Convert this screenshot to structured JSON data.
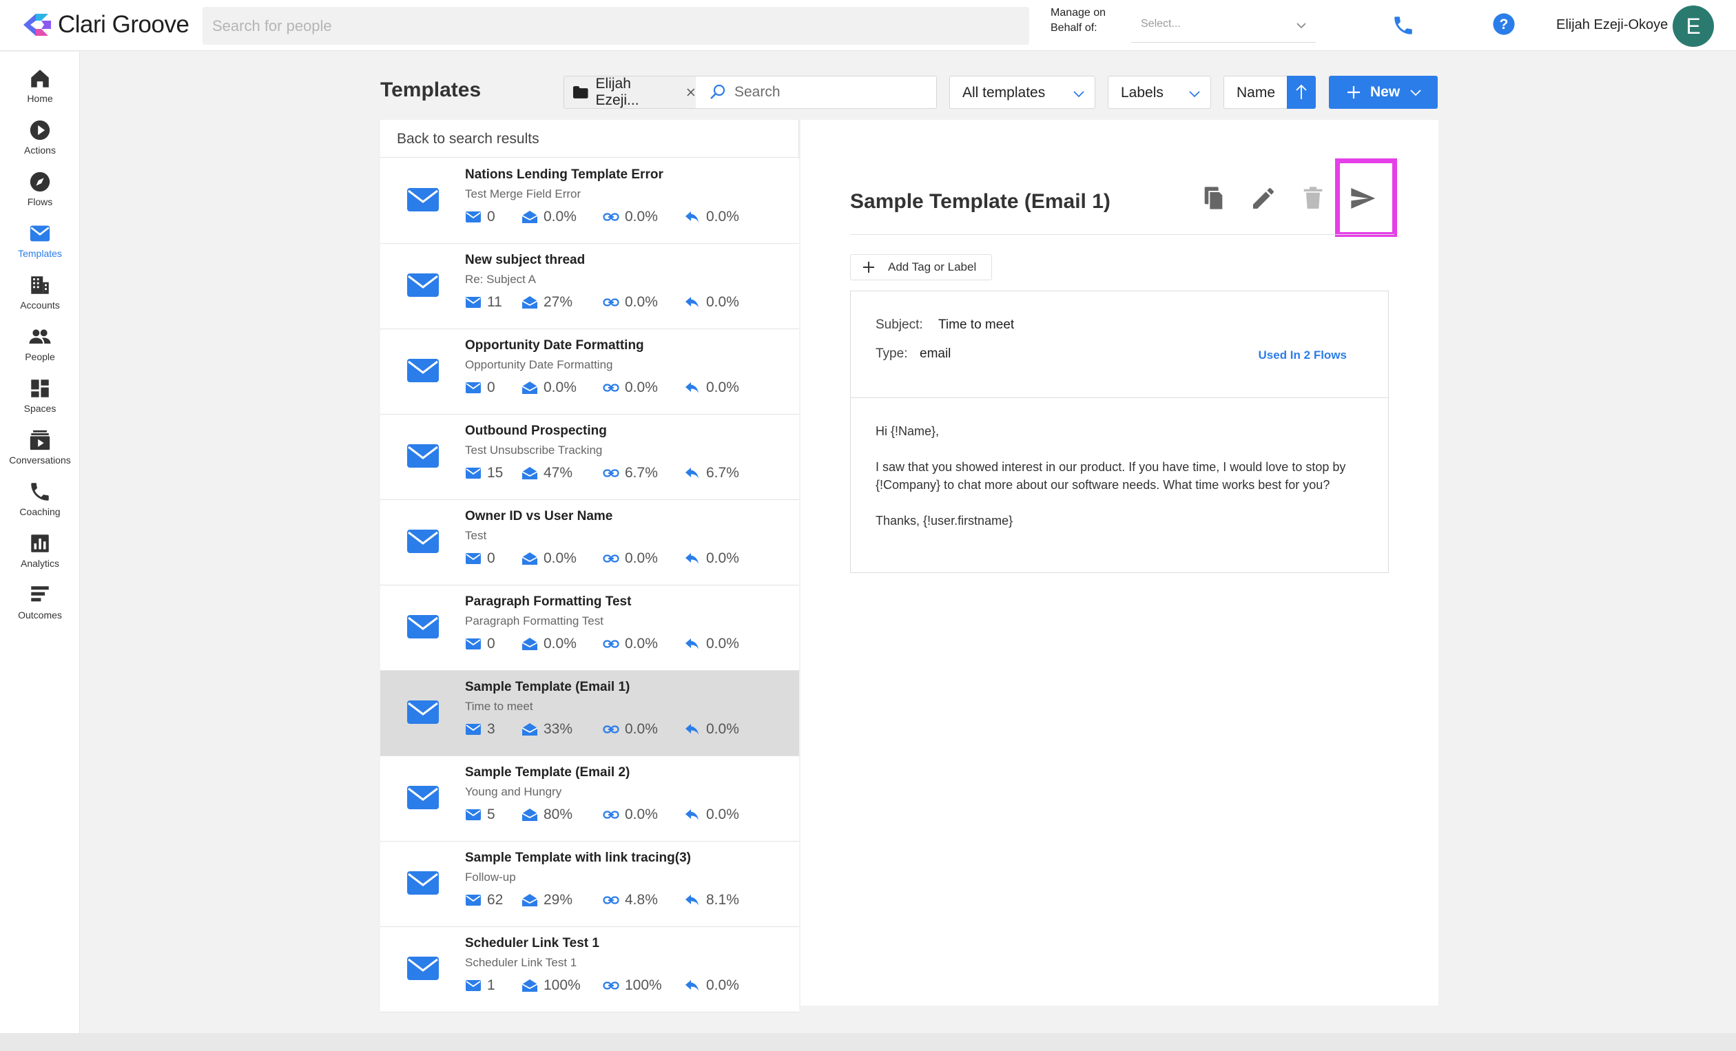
{
  "app": {
    "brand": "Clari Groove"
  },
  "header": {
    "people_search_placeholder": "Search for people",
    "manage_label": "Manage on Behalf of:",
    "behalf_placeholder": "Select...",
    "user_name": "Elijah Ezeji-Okoye",
    "avatar_initial": "E"
  },
  "sidebar": {
    "items": [
      {
        "label": "Home",
        "icon": "home-icon"
      },
      {
        "label": "Actions",
        "icon": "play-circle-icon"
      },
      {
        "label": "Flows",
        "icon": "compass-icon"
      },
      {
        "label": "Templates",
        "icon": "envelope-icon",
        "active": true
      },
      {
        "label": "Accounts",
        "icon": "building-icon"
      },
      {
        "label": "People",
        "icon": "people-icon"
      },
      {
        "label": "Spaces",
        "icon": "dashboard-icon"
      },
      {
        "label": "Conversations",
        "icon": "conversations-icon"
      },
      {
        "label": "Coaching",
        "icon": "phone-icon"
      },
      {
        "label": "Analytics",
        "icon": "bar-chart-icon"
      },
      {
        "label": "Outcomes",
        "icon": "list-icon"
      }
    ]
  },
  "toolbar": {
    "title": "Templates",
    "folder_filter": "Elijah Ezeji...",
    "search_placeholder": "Search",
    "all_templates": "All templates",
    "labels": "Labels",
    "sort": "Name",
    "new_label": "New"
  },
  "list": {
    "back_label": "Back to search results",
    "rows": [
      {
        "title": "Nations Lending Template Error",
        "subject": "Test Merge Field Error",
        "sent": "0",
        "opened": "0.0%",
        "clicked": "0.0%",
        "replied": "0.0%"
      },
      {
        "title": "New subject thread",
        "subject": "Re: Subject A",
        "sent": "11",
        "opened": "27%",
        "clicked": "0.0%",
        "replied": "0.0%"
      },
      {
        "title": "Opportunity Date Formatting",
        "subject": "Opportunity Date Formatting",
        "sent": "0",
        "opened": "0.0%",
        "clicked": "0.0%",
        "replied": "0.0%"
      },
      {
        "title": "Outbound Prospecting",
        "subject": "Test Unsubscribe Tracking",
        "sent": "15",
        "opened": "47%",
        "clicked": "6.7%",
        "replied": "6.7%"
      },
      {
        "title": "Owner ID vs User Name",
        "subject": "Test",
        "sent": "0",
        "opened": "0.0%",
        "clicked": "0.0%",
        "replied": "0.0%"
      },
      {
        "title": "Paragraph Formatting Test",
        "subject": "Paragraph Formatting Test",
        "sent": "0",
        "opened": "0.0%",
        "clicked": "0.0%",
        "replied": "0.0%"
      },
      {
        "title": "Sample Template (Email 1)",
        "subject": "Time to meet",
        "sent": "3",
        "opened": "33%",
        "clicked": "0.0%",
        "replied": "0.0%",
        "selected": true
      },
      {
        "title": "Sample Template (Email 2)",
        "subject": "Young and Hungry",
        "sent": "5",
        "opened": "80%",
        "clicked": "0.0%",
        "replied": "0.0%"
      },
      {
        "title": "Sample Template with link tracing(3)",
        "subject": "Follow-up",
        "sent": "62",
        "opened": "29%",
        "clicked": "4.8%",
        "replied": "8.1%"
      },
      {
        "title": "Scheduler Link Test 1",
        "subject": "Scheduler Link Test 1",
        "sent": "1",
        "opened": "100%",
        "clicked": "100%",
        "replied": "0.0%"
      }
    ]
  },
  "detail": {
    "title": "Sample Template (Email 1)",
    "add_tag_label": "Add Tag or Label",
    "subject_label": "Subject:",
    "subject_value": "Time to meet",
    "type_label": "Type:",
    "type_value": "email",
    "used_in": "Used In 2 Flows",
    "body": {
      "greeting": "Hi {!Name},",
      "paragraph": "I saw that you showed interest in our product. If you have time, I would love to stop by {!Company} to chat more about our software needs. What time works best for you?",
      "signoff": "Thanks, {!user.firstname}"
    }
  },
  "colors": {
    "accent": "#2b7de9",
    "highlight": "#e53fe8",
    "avatar": "#2b7a6f",
    "selected_row": "#dcdcdc"
  }
}
